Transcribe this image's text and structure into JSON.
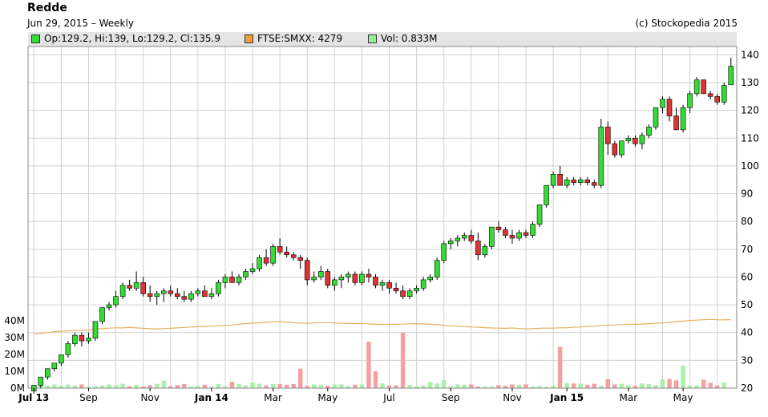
{
  "header": {
    "title": "Redde",
    "subtitle": "Jun 29, 2015 – Weekly",
    "copyright": "(c) Stockopedia 2015"
  },
  "legend": [
    {
      "label": "Op:129.2, Hi:139, Lo:129.2, Cl:135.9",
      "color": "#33dd33"
    },
    {
      "label": "FTSE:SMXX: 4279",
      "color": "#f0a040"
    },
    {
      "label": "Vol: 0.833M",
      "color": "#99ee99"
    }
  ],
  "colors": {
    "up": "#33dd33",
    "down": "#dd3333",
    "index_line": "#e8b060",
    "vol_up": "#aaf0aa",
    "vol_down": "#f4a0a0",
    "grid": "#d0d0d0"
  },
  "chart_data": {
    "type": "candlestick",
    "x_ticks": [
      {
        "label": "Jul 13",
        "week": 0,
        "bold": true
      },
      {
        "label": "Sep",
        "week": 8,
        "bold": false
      },
      {
        "label": "Nov",
        "week": 17,
        "bold": false
      },
      {
        "label": "Jan 14",
        "week": 26,
        "bold": true
      },
      {
        "label": "Mar",
        "week": 35,
        "bold": false
      },
      {
        "label": "May",
        "week": 43,
        "bold": false
      },
      {
        "label": "Jul",
        "week": 52,
        "bold": false
      },
      {
        "label": "Sep",
        "week": 61,
        "bold": false
      },
      {
        "label": "Nov",
        "week": 70,
        "bold": false
      },
      {
        "label": "Jan 15",
        "week": 78,
        "bold": true
      },
      {
        "label": "Mar",
        "week": 87,
        "bold": false
      },
      {
        "label": "May",
        "week": 95,
        "bold": false
      }
    ],
    "price_axis": {
      "min": 20,
      "max": 143,
      "ticks": [
        20,
        30,
        40,
        50,
        60,
        70,
        80,
        90,
        100,
        110,
        120,
        130,
        140
      ]
    },
    "volume_axis": {
      "min": 0,
      "max": 40,
      "unit": "M",
      "ticks": [
        0,
        10,
        20,
        30,
        40
      ],
      "tick_labels": [
        "0M",
        "10M",
        "20M",
        "30M",
        "40M"
      ]
    },
    "candles": [
      [
        19,
        21,
        18,
        21
      ],
      [
        21,
        24,
        20,
        24
      ],
      [
        24,
        27,
        23,
        27
      ],
      [
        27,
        29,
        26,
        29
      ],
      [
        29,
        32,
        28,
        32
      ],
      [
        32,
        37,
        31,
        36
      ],
      [
        36,
        40,
        35,
        39
      ],
      [
        39,
        40,
        35,
        37
      ],
      [
        37,
        40,
        36,
        38
      ],
      [
        38,
        44,
        37,
        44
      ],
      [
        44,
        49,
        43,
        49
      ],
      [
        49,
        51,
        48,
        50
      ],
      [
        50,
        55,
        49,
        53
      ],
      [
        53,
        58,
        52,
        57
      ],
      [
        57,
        59,
        55,
        56
      ],
      [
        56,
        62,
        55,
        58
      ],
      [
        58,
        60,
        53,
        54
      ],
      [
        54,
        57,
        51,
        53
      ],
      [
        53,
        55,
        50,
        54
      ],
      [
        54,
        56,
        51,
        55
      ],
      [
        55,
        57,
        53,
        54
      ],
      [
        54,
        56,
        52,
        53
      ],
      [
        53,
        55,
        51,
        52
      ],
      [
        52,
        55,
        51,
        54
      ],
      [
        54,
        56,
        53,
        55
      ],
      [
        55,
        57,
        53,
        53
      ],
      [
        53,
        56,
        52,
        54
      ],
      [
        54,
        59,
        53,
        58
      ],
      [
        58,
        61,
        56,
        60
      ],
      [
        60,
        62,
        58,
        58
      ],
      [
        58,
        61,
        57,
        60
      ],
      [
        60,
        63,
        59,
        62
      ],
      [
        62,
        65,
        61,
        63
      ],
      [
        63,
        68,
        62,
        67
      ],
      [
        67,
        70,
        64,
        65
      ],
      [
        65,
        72,
        64,
        71
      ],
      [
        71,
        74,
        68,
        69
      ],
      [
        69,
        71,
        67,
        68
      ],
      [
        68,
        69,
        66,
        67
      ],
      [
        67,
        68,
        63,
        66
      ],
      [
        66,
        67,
        57,
        59
      ],
      [
        59,
        62,
        58,
        60
      ],
      [
        60,
        64,
        59,
        62
      ],
      [
        62,
        63,
        56,
        57
      ],
      [
        57,
        60,
        55,
        59
      ],
      [
        59,
        61,
        56,
        60
      ],
      [
        60,
        62,
        58,
        61
      ],
      [
        61,
        62,
        57,
        58
      ],
      [
        58,
        62,
        57,
        61
      ],
      [
        61,
        63,
        58,
        60
      ],
      [
        60,
        61,
        56,
        57
      ],
      [
        57,
        59,
        55,
        58
      ],
      [
        58,
        59,
        54,
        56
      ],
      [
        56,
        58,
        54,
        55
      ],
      [
        55,
        57,
        52,
        53
      ],
      [
        53,
        56,
        52,
        55
      ],
      [
        55,
        57,
        54,
        56
      ],
      [
        56,
        60,
        55,
        59
      ],
      [
        59,
        61,
        58,
        60
      ],
      [
        60,
        67,
        59,
        66
      ],
      [
        66,
        73,
        65,
        72
      ],
      [
        72,
        74,
        70,
        73
      ],
      [
        73,
        75,
        71,
        74
      ],
      [
        74,
        76,
        73,
        75
      ],
      [
        75,
        77,
        72,
        73
      ],
      [
        73,
        76,
        66,
        68
      ],
      [
        68,
        72,
        67,
        71
      ],
      [
        71,
        78,
        70,
        78
      ],
      [
        78,
        80,
        76,
        77
      ],
      [
        77,
        78,
        74,
        75
      ],
      [
        75,
        77,
        72,
        74
      ],
      [
        74,
        77,
        73,
        76
      ],
      [
        76,
        77,
        74,
        75
      ],
      [
        75,
        80,
        74,
        79
      ],
      [
        79,
        86,
        78,
        86
      ],
      [
        86,
        93,
        85,
        93
      ],
      [
        93,
        98,
        92,
        97
      ],
      [
        97,
        100,
        93,
        93
      ],
      [
        93,
        96,
        92,
        95
      ],
      [
        95,
        96,
        93,
        94
      ],
      [
        94,
        96,
        93,
        95
      ],
      [
        95,
        96,
        93,
        94
      ],
      [
        94,
        95,
        92,
        93
      ],
      [
        93,
        117,
        92,
        114
      ],
      [
        114,
        116,
        104,
        108
      ],
      [
        108,
        109,
        103,
        104
      ],
      [
        104,
        109,
        103,
        109
      ],
      [
        109,
        111,
        108,
        110
      ],
      [
        110,
        111,
        107,
        108
      ],
      [
        108,
        112,
        106,
        111
      ],
      [
        111,
        115,
        110,
        114
      ],
      [
        114,
        121,
        113,
        121
      ],
      [
        121,
        125,
        119,
        124
      ],
      [
        124,
        125,
        116,
        118
      ],
      [
        118,
        121,
        113,
        113
      ],
      [
        113,
        122,
        112,
        121
      ],
      [
        121,
        127,
        119,
        126
      ],
      [
        126,
        132,
        125,
        131
      ],
      [
        131,
        128,
        126,
        126
      ],
      [
        126,
        127,
        124,
        125
      ],
      [
        125,
        126,
        122,
        123
      ],
      [
        123,
        130,
        122,
        129
      ],
      [
        129.2,
        139,
        129.2,
        135.9
      ]
    ],
    "volume": [
      2,
      2.4,
      1.6,
      2.2,
      1.4,
      2.2,
      1.6,
      2.2,
      0.9,
      1.2,
      1.6,
      2.2,
      1.8,
      2.6,
      1.2,
      2,
      1,
      1.8,
      2.6,
      4.4,
      1.2,
      1.8,
      2.4,
      1,
      1.4,
      2,
      1,
      2.4,
      1.2,
      3.8,
      2.4,
      1.6,
      3.4,
      2.6,
      1.6,
      2.4,
      2.4,
      2,
      2.4,
      11.6,
      1.4,
      2.2,
      2,
      1.4,
      2.2,
      2.2,
      1.4,
      2,
      2.2,
      27.6,
      10,
      2.8,
      1.6,
      1.6,
      33,
      2,
      1.2,
      1.6,
      3.6,
      2.8,
      4.8,
      1.2,
      2.2,
      2,
      2.2,
      1,
      1,
      1,
      1.8,
      1.4,
      2.2,
      2,
      2.2,
      1,
      1.2,
      0.8,
      1.4,
      24.5,
      3,
      2.8,
      2.6,
      2,
      2.6,
      1.4,
      5.4,
      2.2,
      2.6,
      1.8,
      1.4,
      2.8,
      2.4,
      1.8,
      5.2,
      5.4,
      4.6,
      13.4,
      1.6,
      1.6,
      5,
      3.2,
      1.6,
      3.4
    ],
    "index_line": [
      32,
      32.5,
      33,
      33.5,
      33.8,
      34,
      34.2,
      34.3,
      34.5,
      35,
      35.3,
      35.6,
      35.8,
      35.8,
      36,
      35.8,
      35.5,
      35.3,
      35.2,
      35.4,
      35.5,
      35.8,
      36,
      36.3,
      36.5,
      36.6,
      36.8,
      37,
      37.2,
      37.5,
      38,
      38.3,
      38.6,
      38.8,
      39.1,
      39.4,
      39.5,
      39.3,
      38.9,
      38.6,
      38.5,
      38.7,
      38.9,
      38.9,
      38.7,
      38.5,
      38.4,
      38.3,
      38.4,
      38.2,
      37.9,
      37.8,
      37.9,
      37.9,
      38,
      38.2,
      38.3,
      38.2,
      37.9,
      37.6,
      37.3,
      37,
      36.8,
      36.6,
      36.3,
      36.2,
      35.9,
      35.7,
      35.6,
      35.5,
      35.7,
      35.4,
      35.2,
      35.3,
      35.5,
      35.6,
      35.6,
      35.8,
      35.9,
      36.1,
      36.3,
      36.6,
      36.8,
      37.2,
      37.4,
      37.5,
      37.7,
      37.9,
      37.9,
      38.1,
      38.3,
      38.5,
      38.7,
      39,
      39.5,
      39.8,
      40.2,
      40.4,
      40.6,
      40.8,
      40.6,
      40.5,
      40.7
    ]
  }
}
